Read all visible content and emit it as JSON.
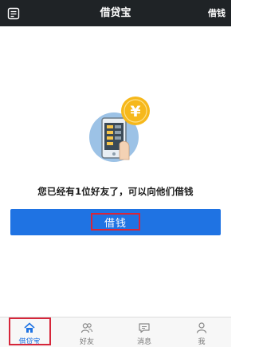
{
  "header": {
    "title": "借贷宝",
    "action_label": "借钱",
    "menu_icon": "menu-doc-icon"
  },
  "main": {
    "illustration_icon": "phone-yen-icon",
    "illustration_symbol": "¥",
    "message": "您已经有1位好友了，可以向他们借钱",
    "borrow_button_label": "借钱"
  },
  "tabs": [
    {
      "label": "借贷宝",
      "icon": "home-icon",
      "active": true
    },
    {
      "label": "好友",
      "icon": "friends-icon",
      "active": false
    },
    {
      "label": "消息",
      "icon": "message-icon",
      "active": false
    },
    {
      "label": "我",
      "icon": "person-icon",
      "active": false
    }
  ],
  "colors": {
    "topbar": "#1f2326",
    "accent": "#1f73e3",
    "highlight": "#d6263a",
    "coin": "#f6b81b",
    "circle": "#9cc2e6"
  }
}
